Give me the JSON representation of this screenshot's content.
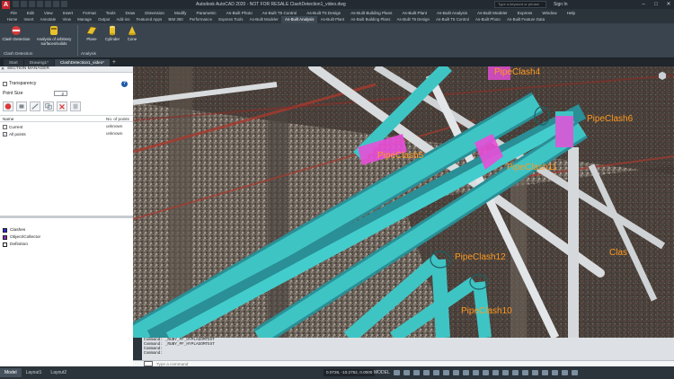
{
  "titlebar": {
    "logo": "A",
    "title": "Autodesk AutoCAD 2020 - NOT FOR RESALE    ClashDetection1_video.dwg",
    "search_placeholder": "Type a keyword or phrase",
    "signin": "Sign In",
    "window_controls": [
      "–",
      "□",
      "✕"
    ]
  },
  "menu": [
    "File",
    "Edit",
    "View",
    "Insert",
    "Format",
    "Tools",
    "Draw",
    "Dimension",
    "Modify",
    "Parametric",
    "As-Built Photo",
    "As-Built T5 Control",
    "As-Built T5 Design",
    "As-Built Building Plans",
    "As-Built Plant",
    "As-Built Analysis",
    "As-Built Modeler",
    "Express",
    "Window",
    "Help"
  ],
  "ribbon_tabs": [
    {
      "label": "Home",
      "active": false
    },
    {
      "label": "Insert",
      "active": false
    },
    {
      "label": "Annotate",
      "active": false
    },
    {
      "label": "View",
      "active": false
    },
    {
      "label": "Manage",
      "active": false
    },
    {
      "label": "Output",
      "active": false
    },
    {
      "label": "Add-ins",
      "active": false
    },
    {
      "label": "Featured Apps",
      "active": false
    },
    {
      "label": "BIM 360",
      "active": false
    },
    {
      "label": "Performance",
      "active": false
    },
    {
      "label": "Express Tools",
      "active": false
    },
    {
      "label": "As-Built Modeler",
      "active": false
    },
    {
      "label": "As-Built Analysis",
      "active": true
    },
    {
      "label": "As-Built Plant",
      "active": false
    },
    {
      "label": "As-Built Building Plans",
      "active": false
    },
    {
      "label": "As-Built T5 Design",
      "active": false
    },
    {
      "label": "As-Built T5 Control",
      "active": false
    },
    {
      "label": "As-Built Photo",
      "active": false
    },
    {
      "label": "As-Built Feature Data",
      "active": false
    }
  ],
  "ribbon": {
    "clash_detection": "Clash Detection",
    "analysis_arbitrary": "Analysis of arbitrary surfaces/solids",
    "plane": "Plane",
    "cylinder": "Cylinder",
    "cone": "Cone",
    "panel_clash": "Clash Detection",
    "panel_analysis": "Analysis"
  },
  "doc_tabs": [
    {
      "label": "Start",
      "active": false
    },
    {
      "label": "Drawing1*",
      "active": false
    },
    {
      "label": "ClashDetection1_video*",
      "active": true
    }
  ],
  "palette": {
    "title": "SECTION MANAGER",
    "transparency_label": "Transparency",
    "point_size_label": "Point Size",
    "point_size_value": "2",
    "col_name": "Name",
    "col_points": "No. of points",
    "rows": [
      {
        "name": "Current",
        "points": "unknown",
        "checked": false
      },
      {
        "name": "All points",
        "points": "unknown",
        "checked": true
      }
    ],
    "layers": [
      {
        "name": "Clashes",
        "color": "#2b2bd6"
      },
      {
        "name": "Object/Collector",
        "color": "#8a2fb5"
      },
      {
        "name": "Definition",
        "color": "#ffffff"
      }
    ]
  },
  "viewport": {
    "labels": [
      "PipeClash4",
      "PipeClash5",
      "PipeClash6",
      "PipeClash11",
      "PipeClash12",
      "PipeClash10",
      "Clas"
    ],
    "colors": {
      "pipe": "#3fc4c4",
      "pipe_dark": "#2a8f96",
      "clash": "#e84fd8",
      "label": "#ff9a1f"
    }
  },
  "command": {
    "history": [
      "Command: _RUBY_PF_HYPLAGOMTEXT",
      "Command: _RUBY_PF_HYPLAGOMTEXT",
      "Command:",
      "Command:"
    ],
    "input_placeholder": "Type a command"
  },
  "status": {
    "layouts": [
      {
        "label": "Model",
        "active": true
      },
      {
        "label": "Layout1",
        "active": false
      },
      {
        "label": "Layout2",
        "active": false
      }
    ],
    "coords": "0.0726, -10.2752, 0.0000",
    "model": "MODEL"
  }
}
